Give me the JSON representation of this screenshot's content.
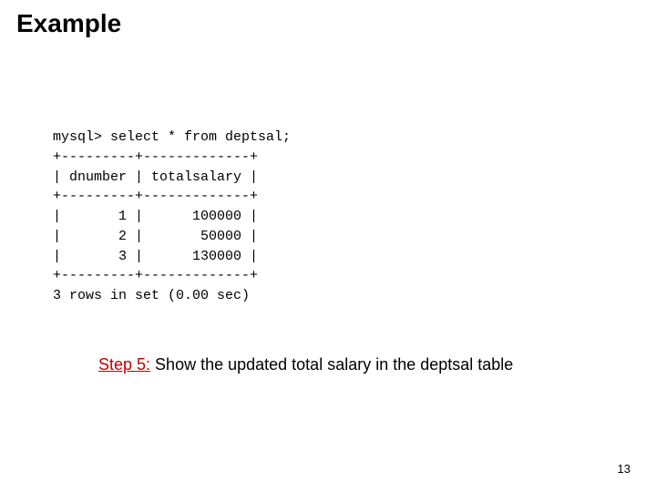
{
  "title": "Example",
  "terminal": {
    "prompt_line": "mysql> select * from deptsal;",
    "border": "+---------+-------------+",
    "header": "| dnumber | totalsalary |",
    "rows": [
      "|       1 |      100000 |",
      "|       2 |       50000 |",
      "|       3 |      130000 |"
    ],
    "summary": "3 rows in set (0.00 sec)"
  },
  "caption": {
    "step_label": "Step 5:",
    "step_text": " Show the updated total salary in the deptsal table"
  },
  "page_number": "13",
  "chart_data": {
    "type": "table",
    "columns": [
      "dnumber",
      "totalsalary"
    ],
    "rows": [
      {
        "dnumber": 1,
        "totalsalary": 100000
      },
      {
        "dnumber": 2,
        "totalsalary": 50000
      },
      {
        "dnumber": 3,
        "totalsalary": 130000
      }
    ],
    "row_count": 3,
    "elapsed_sec": 0.0,
    "query": "select * from deptsal;"
  }
}
